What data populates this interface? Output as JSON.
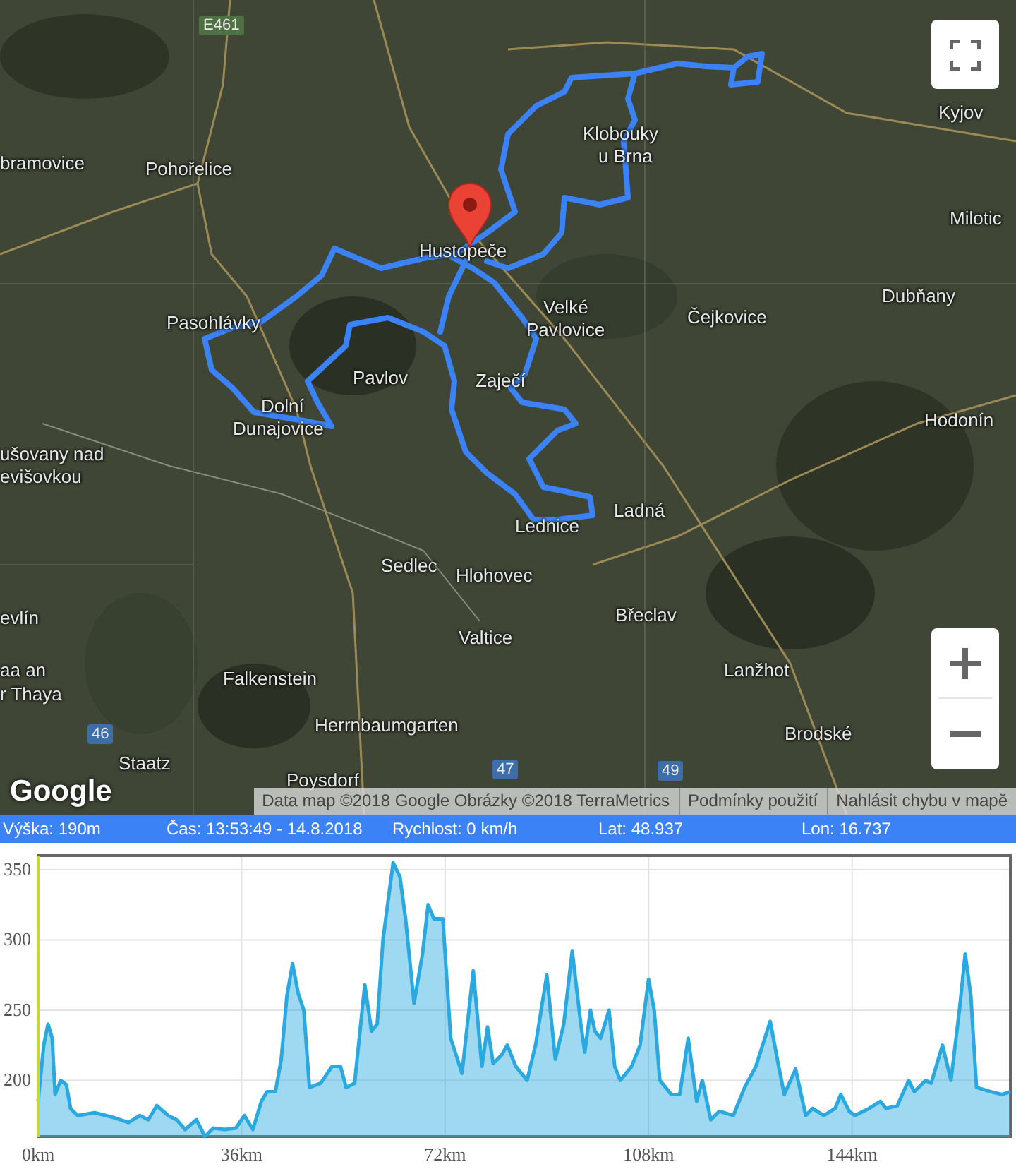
{
  "map": {
    "labels": [
      {
        "kind": "road",
        "text": "E461"
      },
      {
        "kind": "place",
        "text": "bramovice"
      },
      {
        "kind": "place",
        "text": "Pohořelice"
      },
      {
        "kind": "place",
        "text": "Kyjov"
      },
      {
        "kind": "place",
        "text": "Klobouky"
      },
      {
        "kind": "place",
        "text": "u Brna"
      },
      {
        "kind": "place",
        "text": "Hustopeče"
      },
      {
        "kind": "place",
        "text": "Milotic"
      },
      {
        "kind": "place",
        "text": "Velké"
      },
      {
        "kind": "place",
        "text": "Pavlovice"
      },
      {
        "kind": "place",
        "text": "Čejkovice"
      },
      {
        "kind": "place",
        "text": "Dubňany"
      },
      {
        "kind": "place",
        "text": "Pasohlávky"
      },
      {
        "kind": "place",
        "text": "Pavlov"
      },
      {
        "kind": "place",
        "text": "Zaječí"
      },
      {
        "kind": "place",
        "text": "Hodonín"
      },
      {
        "kind": "place",
        "text": "Dolní"
      },
      {
        "kind": "place",
        "text": "Dunajovice"
      },
      {
        "kind": "place",
        "text": "ušovany nad"
      },
      {
        "kind": "place",
        "text": "evišovkou"
      },
      {
        "kind": "place",
        "text": "Ladná"
      },
      {
        "kind": "place",
        "text": "Lednice"
      },
      {
        "kind": "place",
        "text": "Sedlec"
      },
      {
        "kind": "place",
        "text": "Hlohovec"
      },
      {
        "kind": "place",
        "text": "Břeclav"
      },
      {
        "kind": "place",
        "text": "evlín"
      },
      {
        "kind": "place",
        "text": "Valtice"
      },
      {
        "kind": "place",
        "text": "Falkenstein"
      },
      {
        "kind": "place",
        "text": "aa an"
      },
      {
        "kind": "place",
        "text": "r Thaya"
      },
      {
        "kind": "place",
        "text": "Lanžhot"
      },
      {
        "kind": "road",
        "text": "46"
      },
      {
        "kind": "place",
        "text": "Herrnbaumgarten"
      },
      {
        "kind": "place",
        "text": "Brodské"
      },
      {
        "kind": "place",
        "text": "Staatz"
      },
      {
        "kind": "place",
        "text": "Poysdorf"
      },
      {
        "kind": "road",
        "text": "47"
      },
      {
        "kind": "road",
        "text": "49"
      }
    ],
    "logo": "Google",
    "attribution": [
      "Data map ©2018 Google Obrázky ©2018 TerraMetrics",
      "Podmínky použití",
      "Nahlásit chybu v mapě"
    ]
  },
  "status_bar": [
    "Výška: 190m",
    "Čas: 13:53:49 - 14.8.2018",
    "Rychlost: 0 km/h",
    "Lat: 48.937",
    "Lon: 16.737"
  ],
  "elevation_chart": {
    "chart_data": {
      "type": "area",
      "x": [
        0,
        1,
        1.75,
        2.5,
        3,
        4,
        5,
        5.75,
        7,
        10,
        13,
        16,
        18,
        19.5,
        21,
        23,
        24.5,
        26,
        28,
        29.5,
        31,
        33,
        35,
        36.5,
        38,
        39.5,
        40.5,
        42,
        43,
        44,
        45,
        46,
        47,
        48,
        50,
        52,
        53.5,
        54.5,
        56,
        57.8,
        59,
        60,
        61,
        62.8,
        64,
        65,
        66.5,
        68,
        69,
        70,
        71.6,
        73,
        75,
        77,
        78.5,
        79.5,
        80.5,
        82,
        83,
        84.5,
        86.5,
        88,
        90,
        91.5,
        93,
        94.5,
        96,
        96.7,
        97.7,
        98.5,
        99.5,
        101,
        102,
        103,
        105,
        106.5,
        108,
        109,
        110,
        112,
        113.5,
        115,
        116.5,
        117.5,
        119,
        120.5,
        123,
        125,
        127,
        129.5,
        131,
        132,
        134,
        135.8,
        137,
        139,
        141,
        142,
        143.5,
        144.5,
        147,
        149,
        150,
        152,
        154,
        155,
        157,
        158,
        160,
        161.5,
        163,
        164,
        165,
        166,
        168.5,
        170.5,
        172
      ],
      "grid": true,
      "series": [
        {
          "color": "#29a9e0",
          "values": [
            185,
            225,
            240,
            230,
            190,
            200,
            197,
            180,
            175,
            177,
            174,
            170,
            175,
            172,
            182,
            175,
            172,
            165,
            172,
            160,
            166,
            165,
            166,
            175,
            165,
            185,
            192,
            192,
            215,
            260,
            283,
            262,
            250,
            195,
            198,
            210,
            210,
            195,
            198,
            268,
            235,
            240,
            300,
            355,
            345,
            315,
            255,
            290,
            325,
            315,
            315,
            230,
            205,
            278,
            210,
            238,
            212,
            218,
            225,
            210,
            200,
            225,
            275,
            215,
            240,
            292,
            240,
            220,
            250,
            235,
            230,
            250,
            210,
            200,
            210,
            225,
            272,
            250,
            200,
            190,
            190,
            230,
            185,
            200,
            172,
            178,
            175,
            195,
            210,
            242,
            210,
            190,
            208,
            175,
            180,
            175,
            180,
            190,
            178,
            175,
            180,
            185,
            180,
            182,
            200,
            192,
            200,
            198,
            225,
            200,
            250,
            290,
            260,
            195,
            192,
            190,
            192
          ]
        }
      ],
      "xlim": [
        0,
        172
      ],
      "ylim": [
        160,
        360
      ],
      "xticks": [
        {
          "value": 0,
          "label": "0km"
        },
        {
          "value": 36,
          "label": "36km"
        },
        {
          "value": 72,
          "label": "72km"
        },
        {
          "value": 108,
          "label": "108km"
        },
        {
          "value": 144,
          "label": "144km"
        }
      ],
      "yticks": [
        200,
        250,
        300,
        350
      ]
    }
  }
}
